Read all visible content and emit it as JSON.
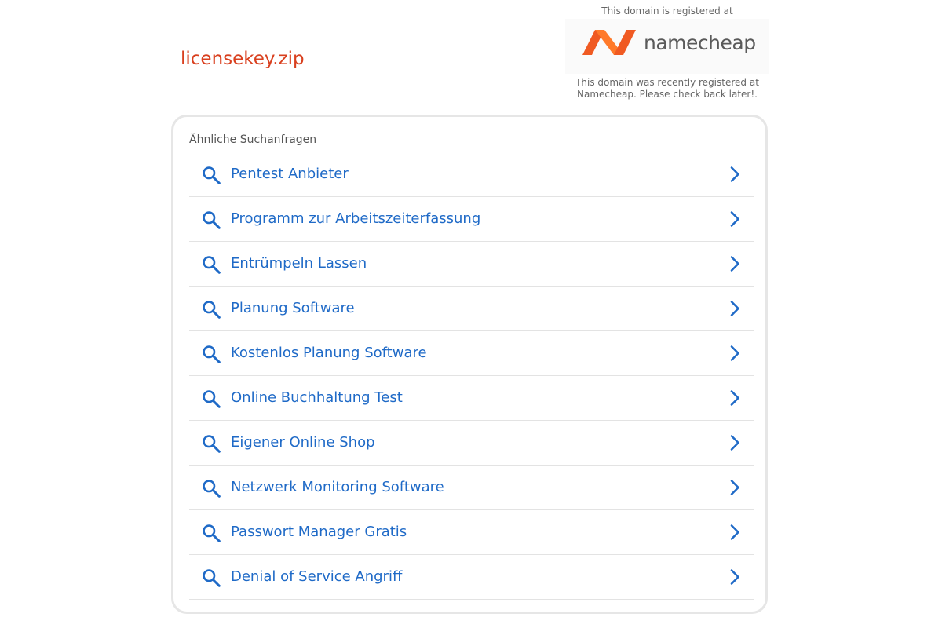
{
  "header": {
    "domain": "licensekey.zip"
  },
  "registrar": {
    "top_text": "This domain is registered at",
    "logo_text": "namecheap",
    "bottom_text_line1": "This domain was recently registered at",
    "bottom_text_line2": "Namecheap. Please check back later!.",
    "brand_colors": [
      "#f05a22",
      "#ff8c2e"
    ]
  },
  "related": {
    "title": "Ähnliche Suchanfragen",
    "link_color": "#1f6ac7",
    "items": [
      {
        "label": "Pentest Anbieter"
      },
      {
        "label": "Programm zur Arbeitszeiterfassung"
      },
      {
        "label": "Entrümpeln Lassen"
      },
      {
        "label": "Planung Software"
      },
      {
        "label": "Kostenlos Planung Software"
      },
      {
        "label": "Online Buchhaltung Test"
      },
      {
        "label": "Eigener Online Shop"
      },
      {
        "label": "Netzwerk Monitoring Software"
      },
      {
        "label": "Passwort Manager Gratis"
      },
      {
        "label": "Denial of Service Angriff"
      }
    ]
  },
  "icons": {
    "row_left": "search-icon",
    "row_right": "chevron-right-icon"
  }
}
